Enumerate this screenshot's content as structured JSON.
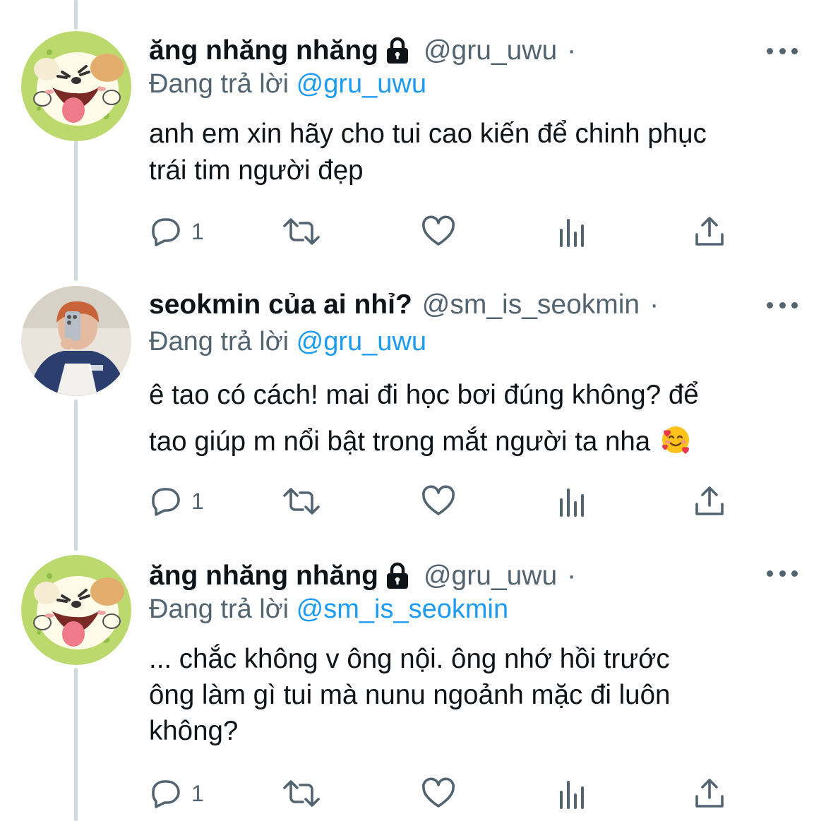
{
  "tweets": [
    {
      "display_name": "ăng nhăng nhăng",
      "protected": true,
      "handle": "@gru_uwu",
      "separator": "·",
      "replying_label": "Đang trả lời",
      "replying_to": "@gru_uwu",
      "text_lines": [
        "anh em xin hãy cho tui cao kiến để chinh phục",
        "trái tim người đẹp"
      ],
      "reply_count": "1",
      "avatar": "cartoon-puppy"
    },
    {
      "display_name": "seokmin của ai nhỉ?",
      "protected": false,
      "handle": "@sm_is_seokmin",
      "separator": "·",
      "replying_label": "Đang trả lời",
      "replying_to": "@gru_uwu",
      "text_lines": [
        "ê tao có cách! mai đi học bơi đúng không? để",
        "tao giúp m nổi bật trong mắt người ta nha"
      ],
      "emoji": "smiling-face-with-hearts",
      "reply_count": "1",
      "avatar": "mirror-selfie-photo"
    },
    {
      "display_name": "ăng nhăng nhăng",
      "protected": true,
      "handle": "@gru_uwu",
      "separator": "·",
      "replying_label": "Đang trả lời",
      "replying_to": "@sm_is_seokmin",
      "text_lines": [
        "... chắc không v ông nội. ông nhớ hồi trước",
        "ông làm gì tui mà nunu ngoảnh mặc đi luôn",
        "không?"
      ],
      "reply_count": "1",
      "avatar": "cartoon-puppy"
    }
  ],
  "icons": [
    "reply-icon",
    "retweet-icon",
    "like-icon",
    "analytics-icon",
    "share-icon",
    "lock-icon",
    "more-icon"
  ],
  "colors": {
    "text": "#0f1419",
    "secondary": "#536471",
    "link": "#1d9bf0",
    "thread_line": "#cfd9de"
  }
}
